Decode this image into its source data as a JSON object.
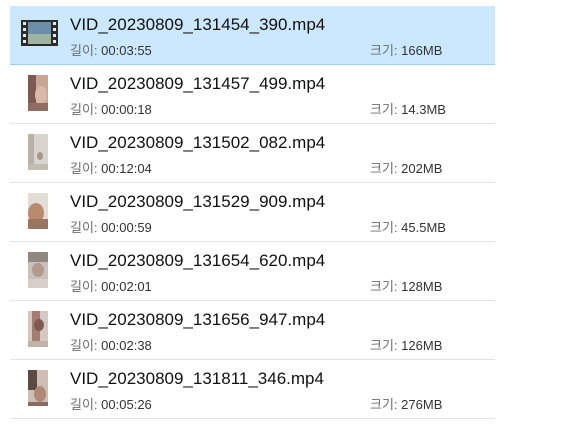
{
  "labels": {
    "duration": "길이:",
    "size": "크기:"
  },
  "files": [
    {
      "name": "VID_20230809_131454_390.mp4",
      "duration": "00:03:55",
      "size": "166MB",
      "selected": true,
      "thumb": "video-film-icon"
    },
    {
      "name": "VID_20230809_131457_499.mp4",
      "duration": "00:00:18",
      "size": "14.3MB",
      "selected": false,
      "thumb": "video-thumbnail"
    },
    {
      "name": "VID_20230809_131502_082.mp4",
      "duration": "00:12:04",
      "size": "202MB",
      "selected": false,
      "thumb": "video-thumbnail"
    },
    {
      "name": "VID_20230809_131529_909.mp4",
      "duration": "00:00:59",
      "size": "45.5MB",
      "selected": false,
      "thumb": "video-thumbnail"
    },
    {
      "name": "VID_20230809_131654_620.mp4",
      "duration": "00:02:01",
      "size": "128MB",
      "selected": false,
      "thumb": "video-thumbnail"
    },
    {
      "name": "VID_20230809_131656_947.mp4",
      "duration": "00:02:38",
      "size": "126MB",
      "selected": false,
      "thumb": "video-thumbnail"
    },
    {
      "name": "VID_20230809_131811_346.mp4",
      "duration": "00:05:26",
      "size": "276MB",
      "selected": false,
      "thumb": "video-thumbnail"
    }
  ],
  "colors": {
    "selection": "#cce8ff",
    "selection_border": "#99d1ff",
    "divider": "#e3e3e3"
  }
}
